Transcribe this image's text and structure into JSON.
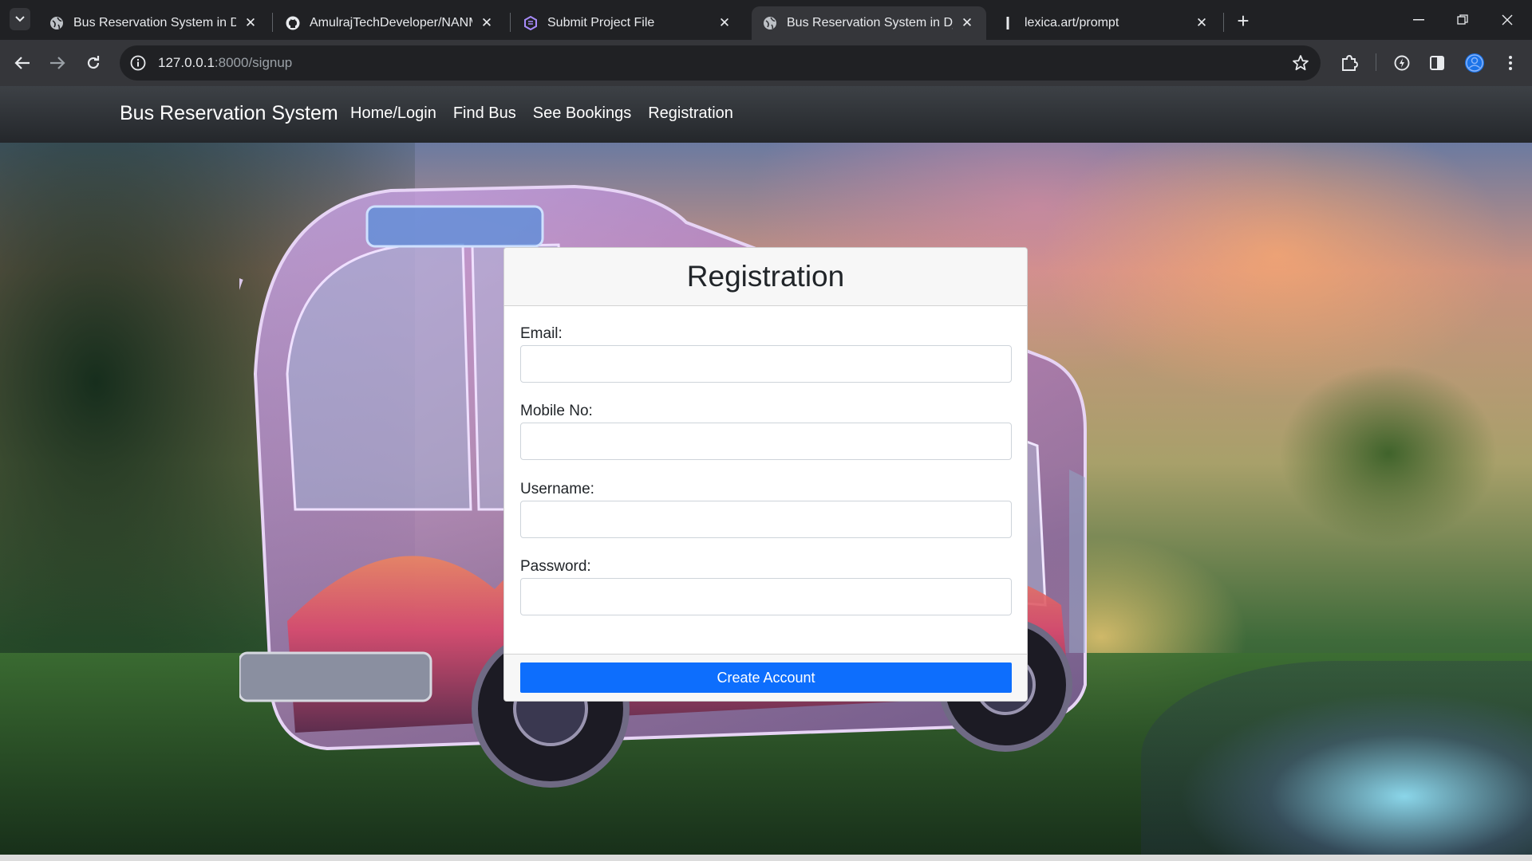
{
  "browser": {
    "tabs": [
      {
        "title": "Bus Reservation System in Djan",
        "icon": "globe-icon",
        "active": false
      },
      {
        "title": "AmulrajTechDeveloper/NANMU",
        "icon": "github-icon",
        "active": false
      },
      {
        "title": "Submit Project File",
        "icon": "form-icon",
        "active": false
      },
      {
        "title": "Bus Reservation System in Djan",
        "icon": "globe-icon",
        "active": true
      },
      {
        "title": "lexica.art/prompt",
        "icon": "lexica-icon",
        "active": false
      }
    ],
    "url_host": "127.0.0.1",
    "url_rest": ":8000/signup",
    "accent_color": "#8ab4f8"
  },
  "site": {
    "brand": "Bus Reservation System",
    "nav": [
      "Home/Login",
      "Find Bus",
      "See Bookings",
      "Registration"
    ]
  },
  "form": {
    "title": "Registration",
    "fields": [
      {
        "label": "Email:",
        "value": ""
      },
      {
        "label": "Mobile No:",
        "value": ""
      },
      {
        "label": "Username:",
        "value": ""
      },
      {
        "label": "Password:",
        "value": ""
      }
    ],
    "submit_label": "Create Account",
    "submit_color": "#0d6efd"
  }
}
